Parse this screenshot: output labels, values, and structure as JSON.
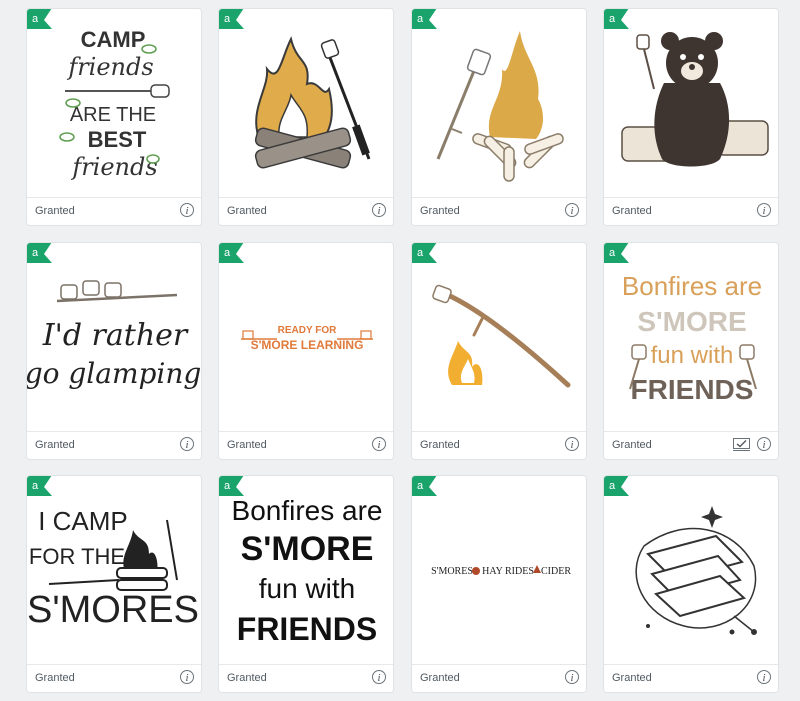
{
  "badge_color": "#1aa36b",
  "badge_letter": "a",
  "cards": [
    {
      "status": "Granted",
      "image_text": [
        "CAMP",
        "friends",
        "ARE THE",
        "BEST",
        "friends"
      ]
    },
    {
      "status": "Granted",
      "image_text": []
    },
    {
      "status": "Granted",
      "image_text": []
    },
    {
      "status": "Granted",
      "image_text": []
    },
    {
      "status": "Granted",
      "image_text": [
        "I'd rather",
        "go glamping"
      ]
    },
    {
      "status": "Granted",
      "image_text": [
        "READY FOR",
        "S'MORE LEARNING"
      ]
    },
    {
      "status": "Granted",
      "image_text": []
    },
    {
      "status": "Granted",
      "image_text": [
        "Bonfires are",
        "S'MORE",
        "fun with",
        "FRIENDS"
      ]
    },
    {
      "status": "Granted",
      "image_text": [
        "I CAMP",
        "FOR THE",
        "S'MORES"
      ]
    },
    {
      "status": "Granted",
      "image_text": [
        "Bonfires are",
        "S'MORE",
        "fun with",
        "FRIENDS"
      ]
    },
    {
      "status": "Granted",
      "image_text": [
        "S'MORES",
        "HAY RIDES",
        "CIDER"
      ]
    },
    {
      "status": "Granted",
      "image_text": []
    }
  ],
  "info_glyph": "i",
  "icons": {
    "info": "info-icon",
    "badge": "access-badge-icon",
    "check": "checkbox-icon"
  }
}
